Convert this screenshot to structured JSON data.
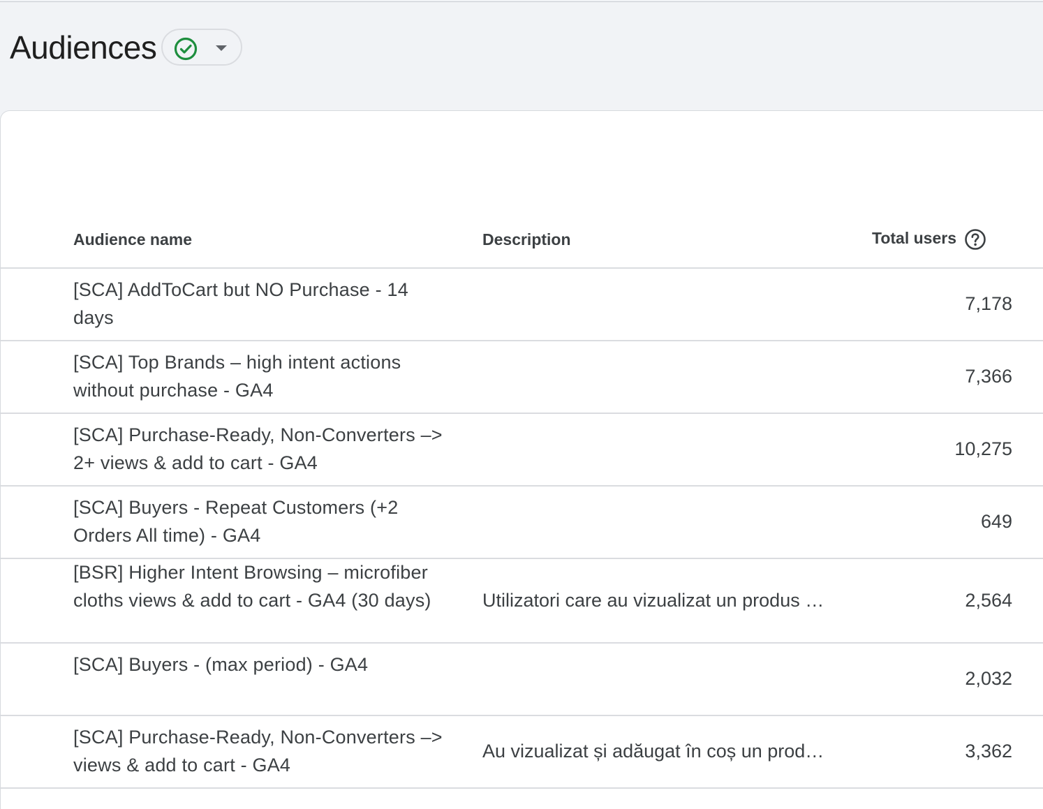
{
  "header": {
    "title": "Audiences",
    "status_icon": "check-circle-icon",
    "dropdown_icon": "caret-down-icon",
    "status_color": "#1e8e3e"
  },
  "table": {
    "columns": {
      "name": "Audience name",
      "description": "Description",
      "total_users": "Total users"
    },
    "help_icon": "help-circle-icon",
    "rows": [
      {
        "name": "[SCA] AddToCart but NO Purchase - 14 days",
        "description": "",
        "total_users": "7,178"
      },
      {
        "name": "[SCA] Top Brands – high intent actions without purchase - GA4",
        "description": "",
        "total_users": "7,366"
      },
      {
        "name": "[SCA] Purchase-Ready, Non-Converters –> 2+ views & add to cart - GA4",
        "description": "",
        "total_users": "10,275"
      },
      {
        "name": "[SCA] Buyers - Repeat Customers (+2 Orders All time) - GA4",
        "description": "",
        "total_users": "649"
      },
      {
        "name": "[BSR] Higher Intent Browsing – microfiber cloths views & add to cart - GA4 (30 days)",
        "description": "Utilizatori care au vizualizat un produs …",
        "total_users": "2,564"
      },
      {
        "name": "[SCA] Buyers - (max period) - GA4",
        "description": "",
        "total_users": "2,032"
      },
      {
        "name": "[SCA] Purchase-Ready, Non-Converters –> views & add to cart - GA4",
        "description": "Au vizualizat și adăugat în coș un prod…",
        "total_users": "3,362"
      }
    ]
  }
}
